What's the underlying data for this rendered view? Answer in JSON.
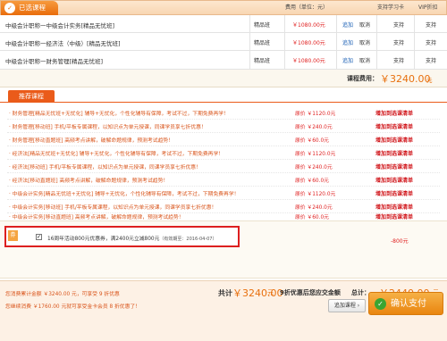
{
  "header": {
    "tab": "已选课程",
    "icon": "cart-icon",
    "col_fee": "费用（单位：元）",
    "col_support1": "支持学习卡",
    "col_support2": "VIP折扣"
  },
  "selected": [
    {
      "name": "中级会计职称一中级会计实务[精品无忧班]",
      "cls": "精品班",
      "price": "￥1080.00元",
      "add": "追加",
      "cancel": "取消",
      "s1": "支持",
      "s2": "支持"
    },
    {
      "name": "中级会计职称一经济法（中级）[精品无忧班]",
      "cls": "精品班",
      "price": "￥1080.00元",
      "add": "追加",
      "cancel": "取消",
      "s1": "支持",
      "s2": "支持"
    },
    {
      "name": "中级会计职称一财务管理[精品无忧班]",
      "cls": "精品班",
      "price": "￥1080.00元",
      "add": "追加",
      "cancel": "取消",
      "s1": "支持",
      "s2": "支持"
    }
  ],
  "fee": {
    "label": "课程费用：",
    "value": "￥3240.00",
    "unit": "元"
  },
  "recommend": {
    "tab": "推荐课程",
    "items": [
      {
        "text": "· 财务管理[精品无忧班+无忧化] 辅导+无忧化，个性化辅导有保障，考试不过，下期免费再学！",
        "price": "原价 ￥1120.0元",
        "action": "增加到选课清单"
      },
      {
        "text": "· 财务管理[移动班] 手机/平板专属课程，以知识点为单元授课，同课学员享七折优惠！",
        "price": "原价 ￥240.0元",
        "action": "增加到选课清单"
      },
      {
        "text": "· 财务管理[移动直题班] 高频考点讲解，破解命题规律，预测考试趋势！",
        "price": "原价 ￥60.0元",
        "action": "增加到选课清单"
      },
      {
        "text": "· 经济法[精品无忧班+无忧化] 辅导+无忧化，个性化辅导有保障，考试不过，下期免费再学！",
        "price": "原价 ￥1120.0元",
        "action": "增加到选课清单"
      },
      {
        "text": "· 经济法[移动班] 手机/平板专属课程，以知识点为单元授课，同课学员享七折优惠！",
        "price": "原价 ￥240.0元",
        "action": "增加到选课清单"
      },
      {
        "text": "· 经济法[移动直题班] 高频考点讲解，破解命题规律，预测考试趋势！",
        "price": "原价 ￥60.0元",
        "action": "增加到选课清单"
      },
      {
        "text": "· 中级会计实务[精品无忧班+无忧化] 辅导+无忧化，个性化辅导有保障，考试不过，下期免费再学！",
        "price": "原价 ￥1120.0元",
        "action": "增加到选课清单"
      },
      {
        "text": "· 中级会计实务[移动班] 手机/平板专属课程，以知识点为单元授课，同课学员享七折优惠！",
        "price": "原价 ￥240.0元",
        "action": "增加到选课清单"
      },
      {
        "text": "· 中级会计实务[移动直题班] 高频考点讲解，破解命题规律，预测考试趋势！",
        "price": "原价 ￥60.0元",
        "action": "增加到选课清单"
      }
    ]
  },
  "discount": {
    "icon": "coupon-icon",
    "text": "16周年活动800元优惠券，满2400元立减800元",
    "validity": "（有效期至：2016-04-07）",
    "checked": "✓",
    "amount": "-800元"
  },
  "summary": {
    "line1": "您消费累计金额 ￥3240.00 元，可享受 9 折优惠",
    "line2": "您继续消费 ￥1760.00 元就可享受金卡会员 8 折优惠了！",
    "total_label": "共计",
    "total_value": "￥3240.00",
    "total_unit": "元",
    "discount_note": "9折优惠后您应交金额",
    "grand_label": "总计：",
    "grand_value": "￥2440.00",
    "grand_unit": "元",
    "add_button": "追加课程 ›",
    "pay_button": "确认支付",
    "pay_icon": "check-icon"
  },
  "colors": {
    "accent": "#e96d0c",
    "price": "#e02020",
    "highlight_border": "#dd1f1f"
  }
}
